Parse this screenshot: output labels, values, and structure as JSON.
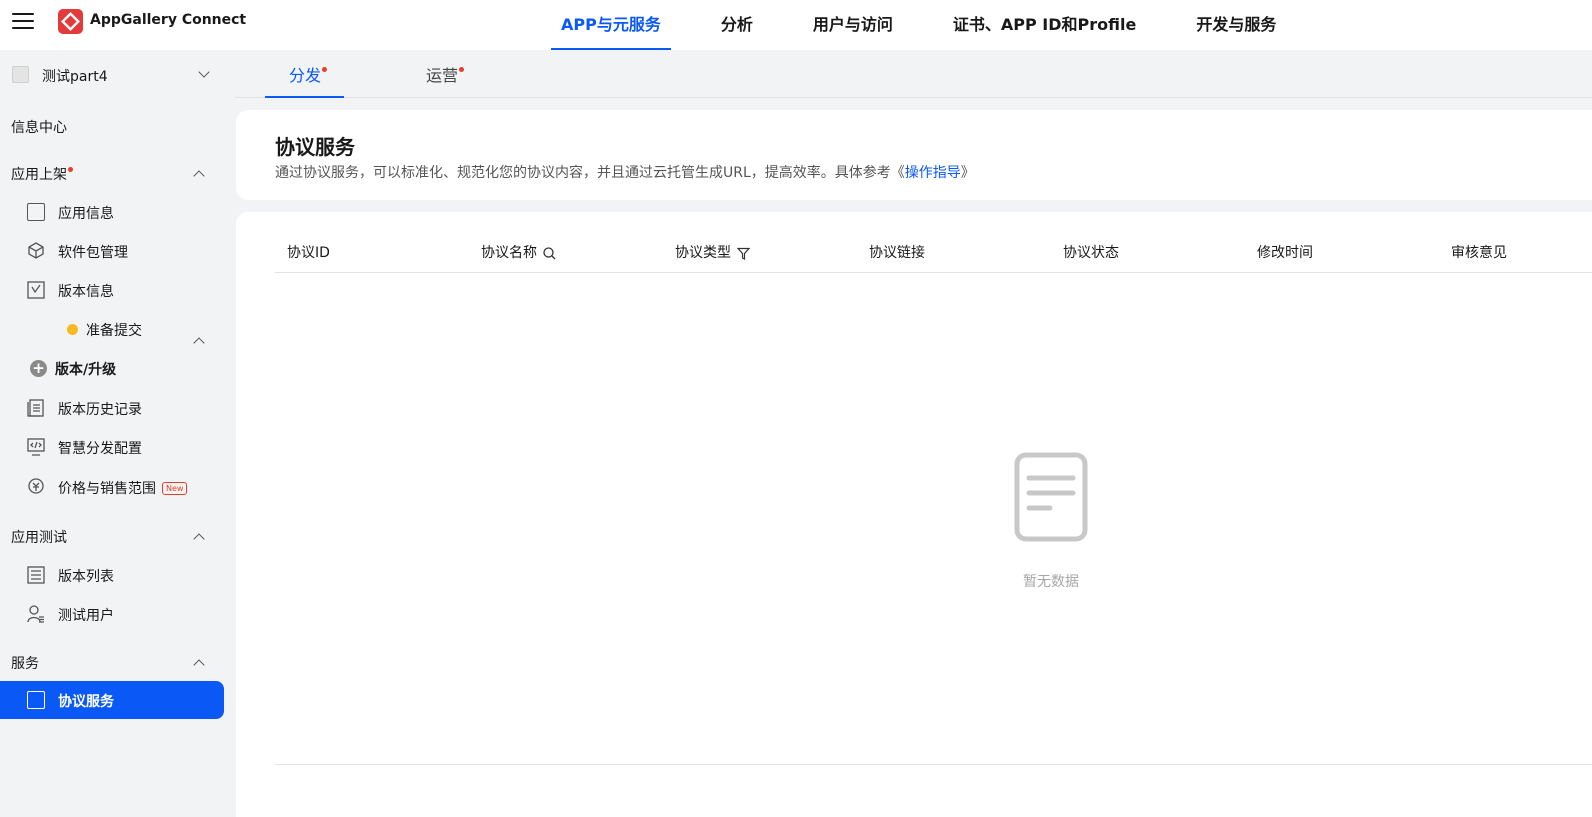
{
  "header": {
    "brand": "AppGallery Connect",
    "nav": [
      "APP与元服务",
      "分析",
      "用户与访问",
      "证书、APP ID和Profile",
      "开发与服务"
    ],
    "active_nav": "APP与元服务"
  },
  "sidebar": {
    "project": "测试part4",
    "info_center": "信息中心",
    "groups": {
      "publish": "应用上架",
      "testing": "应用测试",
      "services": "服务"
    },
    "items": {
      "app_info": "应用信息",
      "package_mgmt": "软件包管理",
      "version_info": "版本信息",
      "ready_submit": "准备提交",
      "version_upgrade": "版本/升级",
      "version_history": "版本历史记录",
      "smart_distribution": "智慧分发配置",
      "price_sales": "价格与销售范围",
      "price_sales_badge": "New",
      "version_list": "版本列表",
      "test_users": "测试用户",
      "agreement_service": "协议服务"
    }
  },
  "tabs": [
    "分发",
    "运营"
  ],
  "main": {
    "title": "协议服务",
    "desc_prefix": "通过协议服务，可以标准化、规范化您的协议内容，并且通过云托管生成URL，提高效率。具体参考《",
    "desc_link": "操作指导",
    "desc_suffix": "》",
    "columns": [
      "协议ID",
      "协议名称",
      "协议类型",
      "协议链接",
      "协议状态",
      "修改时间",
      "审核意见"
    ],
    "empty_text": "暂无数据"
  },
  "colors": {
    "accent": "#0a59f7",
    "logo": "#e33b3b",
    "badge": "#e84026",
    "status_pending": "#f9b91f"
  }
}
